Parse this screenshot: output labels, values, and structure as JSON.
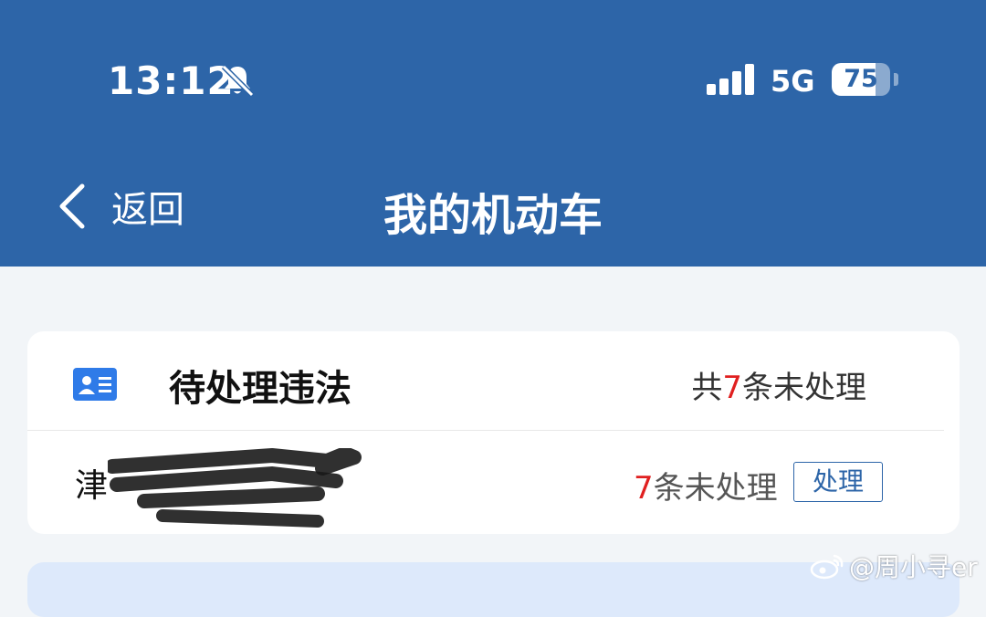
{
  "status_bar": {
    "time": "13:12",
    "mute_icon": "bell-slash-icon",
    "signal_icon": "signal-bars-icon",
    "network": "5G",
    "battery": 75
  },
  "nav": {
    "back_icon": "chevron-left-icon",
    "back_label": "返回",
    "title": "我的机动车"
  },
  "violations_card": {
    "icon": "id-card-icon",
    "title": "待处理违法",
    "summary_prefix": "共",
    "summary_count": "7",
    "summary_suffix": "条未处理",
    "rows": [
      {
        "plate_prefix": "津",
        "count": "7",
        "count_suffix": "条未处理",
        "action_label": "处理"
      }
    ]
  },
  "watermark": {
    "icon": "weibo-icon",
    "text": "@周小寻er"
  },
  "colors": {
    "header": "#2d65a8",
    "background": "#f2f5f8",
    "accent_red": "#e02020"
  }
}
